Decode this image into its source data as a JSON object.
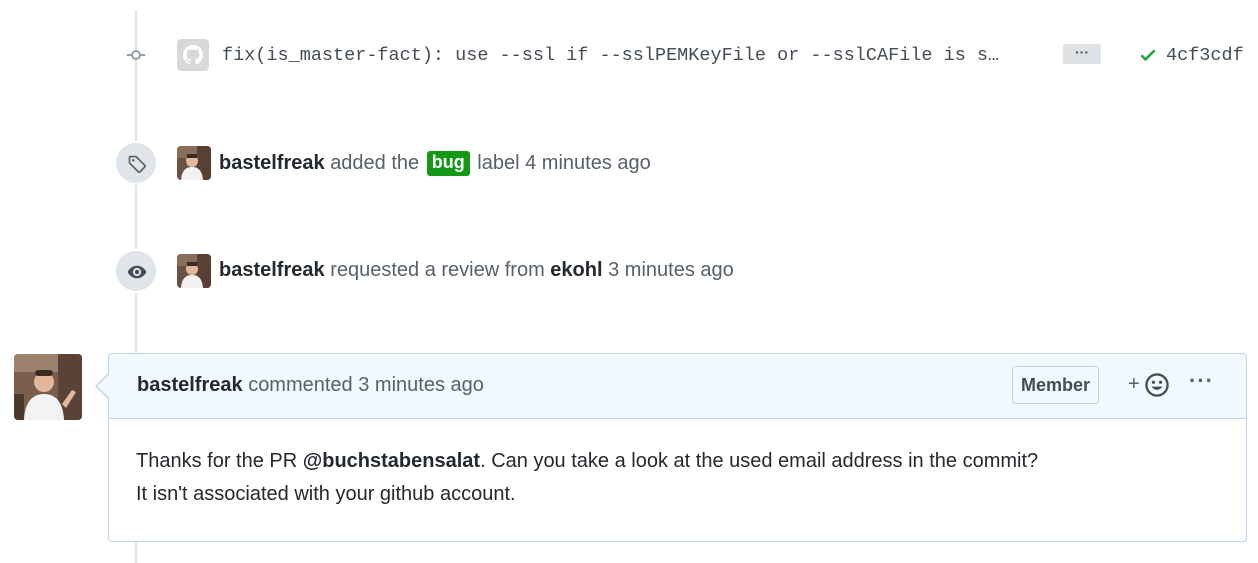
{
  "commit": {
    "message": "fix(is_master-fact): use --ssl if --sslPEMKeyFile or --sslCAFile is s…",
    "ellipsis": "…",
    "sha": "4cf3cdf",
    "status_icon": "check-icon",
    "status_color": "#28a745"
  },
  "label_event": {
    "author": "bastelfreak",
    "text_before": "added the",
    "label": "bug",
    "label_color": "#159818",
    "text_after": "label",
    "time": "4 minutes ago",
    "icon": "tag-icon"
  },
  "review_event": {
    "author": "bastelfreak",
    "text": "requested a review from",
    "reviewer": "ekohl",
    "time": "3 minutes ago",
    "icon": "eye-icon"
  },
  "comment": {
    "author": "bastelfreak",
    "action": "commented",
    "time": "3 minutes ago",
    "role_label": "Member",
    "reaction_plus": "+",
    "more": "···",
    "body_before": "Thanks for the PR ",
    "mention": "@buchstabensalat",
    "body_after": ". Can you take a look at the used email address in the commit?",
    "body_line2": "It isn't associated with your github account."
  }
}
